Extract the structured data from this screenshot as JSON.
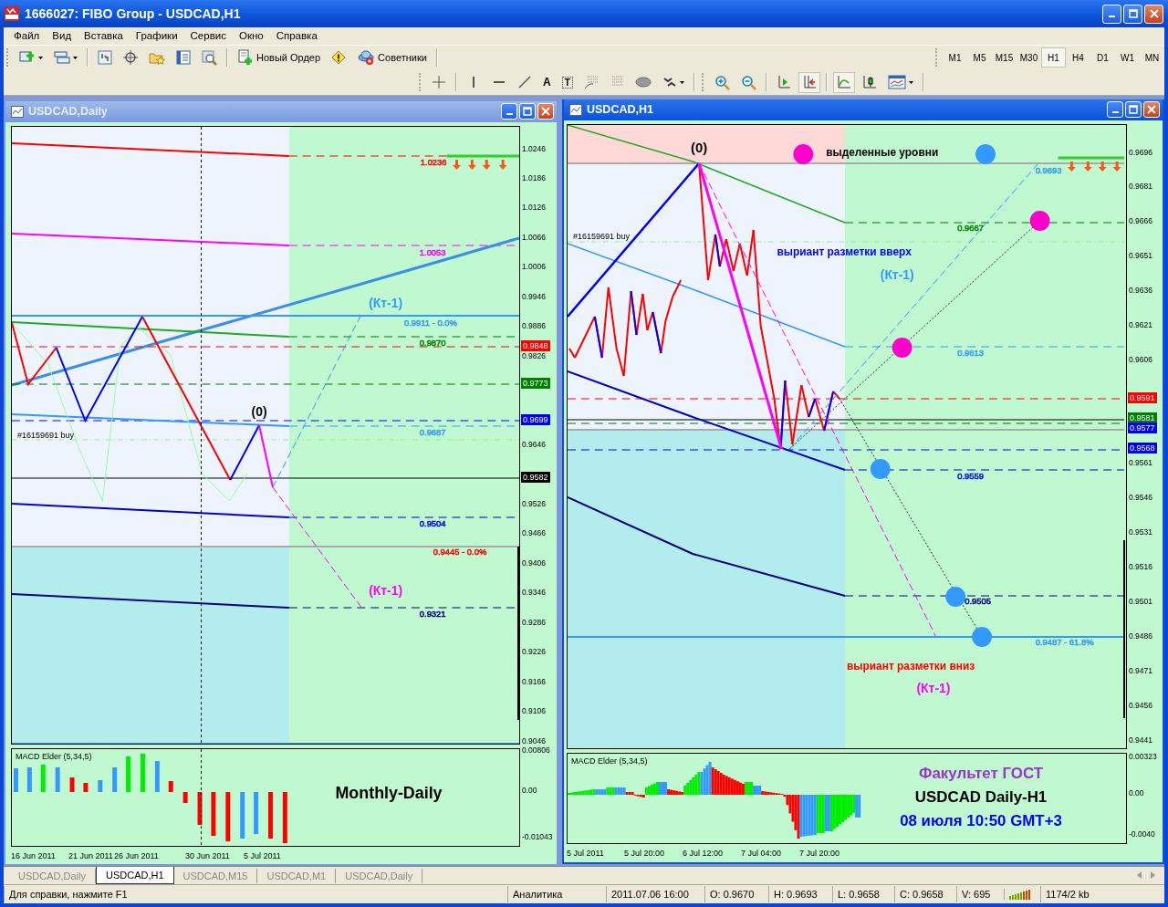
{
  "window": {
    "title": "1666027: FIBO Group - USDCAD,H1"
  },
  "menu": [
    "Файл",
    "Вид",
    "Вставка",
    "Графики",
    "Сервис",
    "Окно",
    "Справка"
  ],
  "toolbar": {
    "new_order": "Новый Ордер",
    "experts": "Советники",
    "text_tool": "A",
    "label_tool": "T"
  },
  "timeframes": [
    {
      "label": "M1",
      "selected": false
    },
    {
      "label": "M5",
      "selected": false
    },
    {
      "label": "M15",
      "selected": false
    },
    {
      "label": "M30",
      "selected": false
    },
    {
      "label": "H1",
      "selected": true
    },
    {
      "label": "H4",
      "selected": false
    },
    {
      "label": "D1",
      "selected": false
    },
    {
      "label": "W1",
      "selected": false
    },
    {
      "label": "MN",
      "selected": false
    }
  ],
  "charts": [
    {
      "title": "USDCAD,Daily",
      "active": false,
      "price_ticks": [
        "1.0246",
        "1.0186",
        "1.0126",
        "1.0066",
        "1.0006",
        "0.9946",
        "0.9886",
        "0.9826",
        "0.9646",
        "0.9526",
        "0.9466",
        "0.9406",
        "0.9346",
        "0.9286",
        "0.9226",
        "0.9166",
        "0.9106",
        "0.9046"
      ],
      "price_badges": [
        {
          "text": "0.9848",
          "color": "#ff0000"
        },
        {
          "text": "0.9773",
          "color": "#008000"
        },
        {
          "text": "0.9699",
          "color": "#0000ff"
        },
        {
          "text": "0.9582",
          "color": "#000000"
        }
      ],
      "levels": [
        {
          "text": "1.0236",
          "color": "#ff0000"
        },
        {
          "text": "1.0053",
          "color": "#ff00ff"
        },
        {
          "text": "0.9911 - 0.0%",
          "color": "#3399ff"
        },
        {
          "text": "0.9870",
          "color": "#008000"
        },
        {
          "text": "0.9687",
          "color": "#3399ff"
        },
        {
          "text": "0.9504",
          "color": "#0000ff"
        },
        {
          "text": "0.9445 - 0.0%",
          "color": "#ff0000"
        },
        {
          "text": "0.9321",
          "color": "#000080"
        }
      ],
      "annotations": [
        {
          "text": "(0)",
          "color": "#000000"
        },
        {
          "text": "(Кт-1)",
          "color": "#3399ff"
        },
        {
          "text": "(Кт-1)",
          "color": "#ff00ff"
        }
      ],
      "order_label": "#16159691 buy",
      "indicator": {
        "name": "MACD Elder (5,34,5)",
        "ticks": [
          "0.00806",
          "0.00",
          "-0.01043"
        ]
      },
      "captions": [
        {
          "text": "Monthly-Daily",
          "color": "#000000"
        }
      ],
      "time_ticks": [
        "16 Jun 2011",
        "21 Jun 2011",
        "26 Jun 2011",
        "30 Jun 2011",
        "5 Jul 2011"
      ]
    },
    {
      "title": "USDCAD,H1",
      "active": true,
      "price_ticks": [
        "0.9696",
        "0.9681",
        "0.9666",
        "0.9651",
        "0.9636",
        "0.9621",
        "0.9606",
        "0.9561",
        "0.9546",
        "0.9531",
        "0.9516",
        "0.9501",
        "0.9486",
        "0.9471",
        "0.9456",
        "0.9441"
      ],
      "price_badges": [
        {
          "text": "0.9591",
          "color": "#ff0000"
        },
        {
          "text": "0.9581",
          "color": "#008000"
        },
        {
          "text": "0.9577",
          "color": "#0000ff"
        },
        {
          "text": "0.9568",
          "color": "#0000ff"
        }
      ],
      "levels": [
        {
          "text": "0.9693",
          "color": "#3399ff"
        },
        {
          "text": "0.9667",
          "color": "#008000"
        },
        {
          "text": "0.9613",
          "color": "#3399ff"
        },
        {
          "text": "0.9559",
          "color": "#0000ff"
        },
        {
          "text": "0.9505",
          "color": "#000080"
        },
        {
          "text": "0.9487 - 61.8%",
          "color": "#3399ff"
        }
      ],
      "annotations": [
        {
          "text": "(0)",
          "color": "#000000"
        },
        {
          "text": "выделенные уровни",
          "color": "#000000"
        },
        {
          "text": "выриант разметки вверх",
          "color": "#0000ff"
        },
        {
          "text": "(Кт-1)",
          "color": "#3399ff"
        },
        {
          "text": "выриант разметки вниз",
          "color": "#ff0000"
        },
        {
          "text": "(Кт-1)",
          "color": "#ff00ff"
        }
      ],
      "order_label": "#16159691 buy",
      "indicator": {
        "name": "MACD Elder (5,34,5)",
        "ticks": [
          "0.00323",
          "0.00",
          "-0.0040"
        ]
      },
      "captions": [
        {
          "text": "Факультет ГОСТ",
          "color": "#9933cc"
        },
        {
          "text": "USDCAD Daily-H1",
          "color": "#000000"
        },
        {
          "text": "08 июля 10:50 GMT+3",
          "color": "#0000ff"
        }
      ],
      "time_ticks": [
        "5 Jul 2011",
        "5 Jul 20:00",
        "6 Jul 12:00",
        "7 Jul 04:00",
        "7 Jul 20:00"
      ]
    }
  ],
  "tabs": [
    {
      "label": "USDCAD,Daily",
      "selected": false
    },
    {
      "label": "USDCAD,H1",
      "selected": true
    },
    {
      "label": "USDCAD,M15",
      "selected": false
    },
    {
      "label": "USDCAD,M1",
      "selected": false
    },
    {
      "label": "USDCAD,Daily",
      "selected": false
    }
  ],
  "status_bar": {
    "help": "Для справки, нажмите F1",
    "profile": "Аналитика",
    "time": "2011.07.06 16:00",
    "open": "O: 0.9670",
    "high": "H: 0.9693",
    "low": "L: 0.9658",
    "close": "C: 0.9658",
    "volume": "V: 695",
    "traffic": "1174/2 kb"
  }
}
